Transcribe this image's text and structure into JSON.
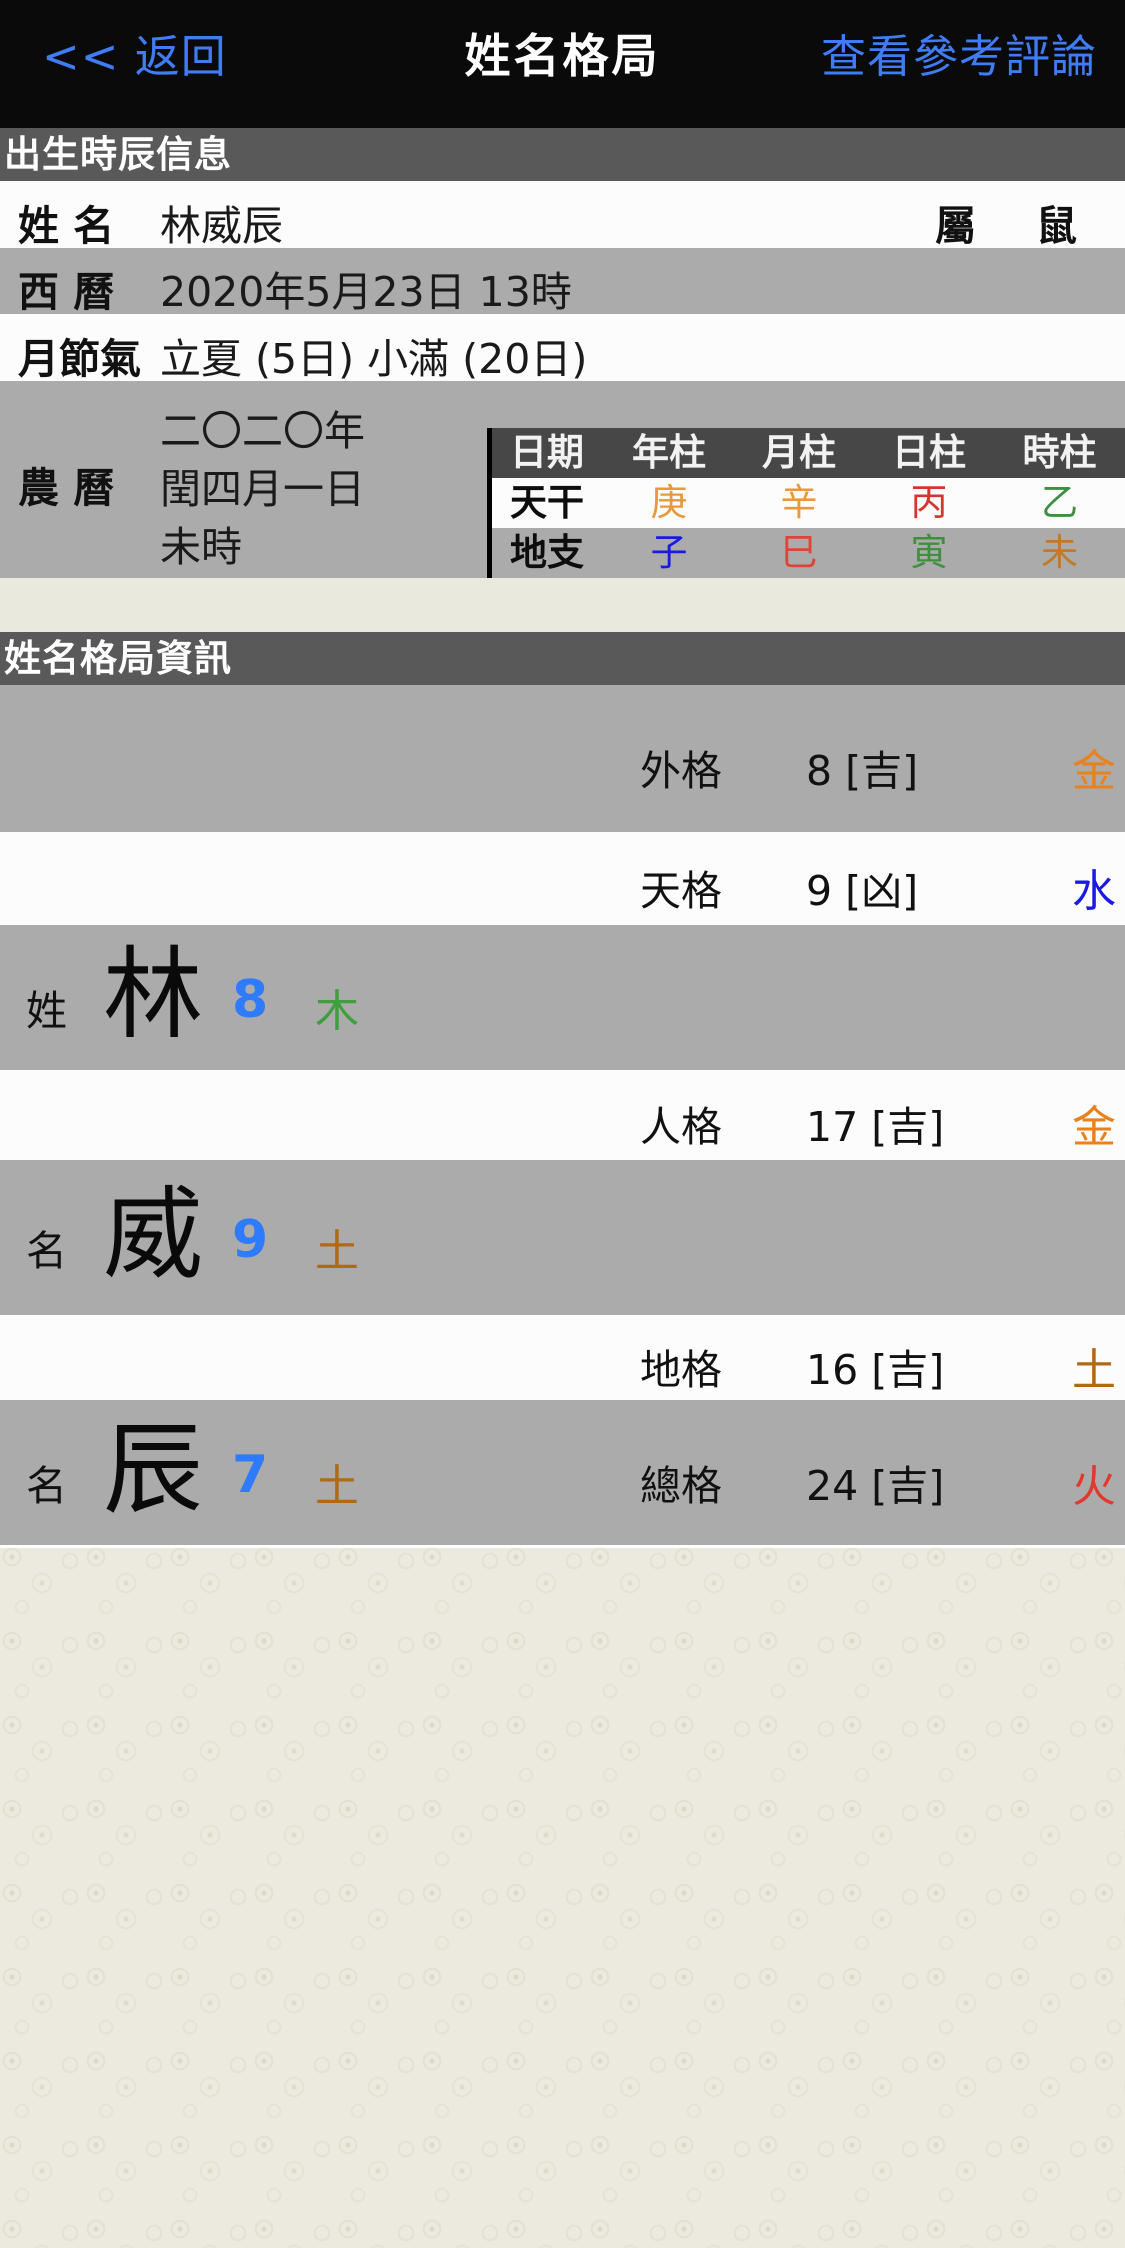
{
  "nav": {
    "back_label": "<< 返回",
    "title": "姓名格局",
    "right_label": "查看參考評論"
  },
  "sections": {
    "birth_header": "出生時辰信息",
    "name_header": "姓名格局資訊"
  },
  "birth_info": {
    "name_label": "姓 名",
    "name_value": "林威辰",
    "zodiac_label": "屬",
    "zodiac_value": "鼠",
    "solar_label": "西 曆",
    "solar_value": "2020年5月23日 13時",
    "solar_term_label": "月節氣",
    "solar_term_value": "立夏 (5日) 小滿 (20日)",
    "lunar_label": "農 曆",
    "lunar_lines": [
      "二〇二〇年",
      "閏四月一日",
      "未時"
    ]
  },
  "bazi_table": {
    "headers": [
      "日期",
      "年柱",
      "月柱",
      "日柱",
      "時柱"
    ],
    "rows": [
      {
        "label": "天干",
        "cells": [
          {
            "text": "庚",
            "color": "#e8993b"
          },
          {
            "text": "辛",
            "color": "#e8993b"
          },
          {
            "text": "丙",
            "color": "#d6352b"
          },
          {
            "text": "乙",
            "color": "#3f8f3f"
          }
        ]
      },
      {
        "label": "地支",
        "cells": [
          {
            "text": "子",
            "color": "#1a1ae0"
          },
          {
            "text": "巳",
            "color": "#e04436"
          },
          {
            "text": "寅",
            "color": "#3f8f3f"
          },
          {
            "text": "未",
            "color": "#c07a2a"
          }
        ]
      }
    ]
  },
  "grid_info": {
    "ge_rows": [
      {
        "name": "外格",
        "value": "8 [吉]",
        "element": "金",
        "color": "#e8821e"
      },
      {
        "name": "天格",
        "value": "9 [凶]",
        "element": "水",
        "color": "#1a1ae0"
      },
      {
        "name": "人格",
        "value": "17 [吉]",
        "element": "金",
        "color": "#e8821e"
      },
      {
        "name": "地格",
        "value": "16 [吉]",
        "element": "土",
        "color": "#b06a14"
      },
      {
        "name": "總格",
        "value": "24 [吉]",
        "element": "火",
        "color": "#e03a2f"
      }
    ],
    "char_rows": [
      {
        "role": "姓",
        "char": "林",
        "strokes": "8",
        "element": "木",
        "color": "#3f9f3f"
      },
      {
        "role": "名",
        "char": "威",
        "strokes": "9",
        "element": "土",
        "color": "#b06a14"
      },
      {
        "role": "名",
        "char": "辰",
        "strokes": "7",
        "element": "土",
        "color": "#b06a14"
      }
    ]
  }
}
